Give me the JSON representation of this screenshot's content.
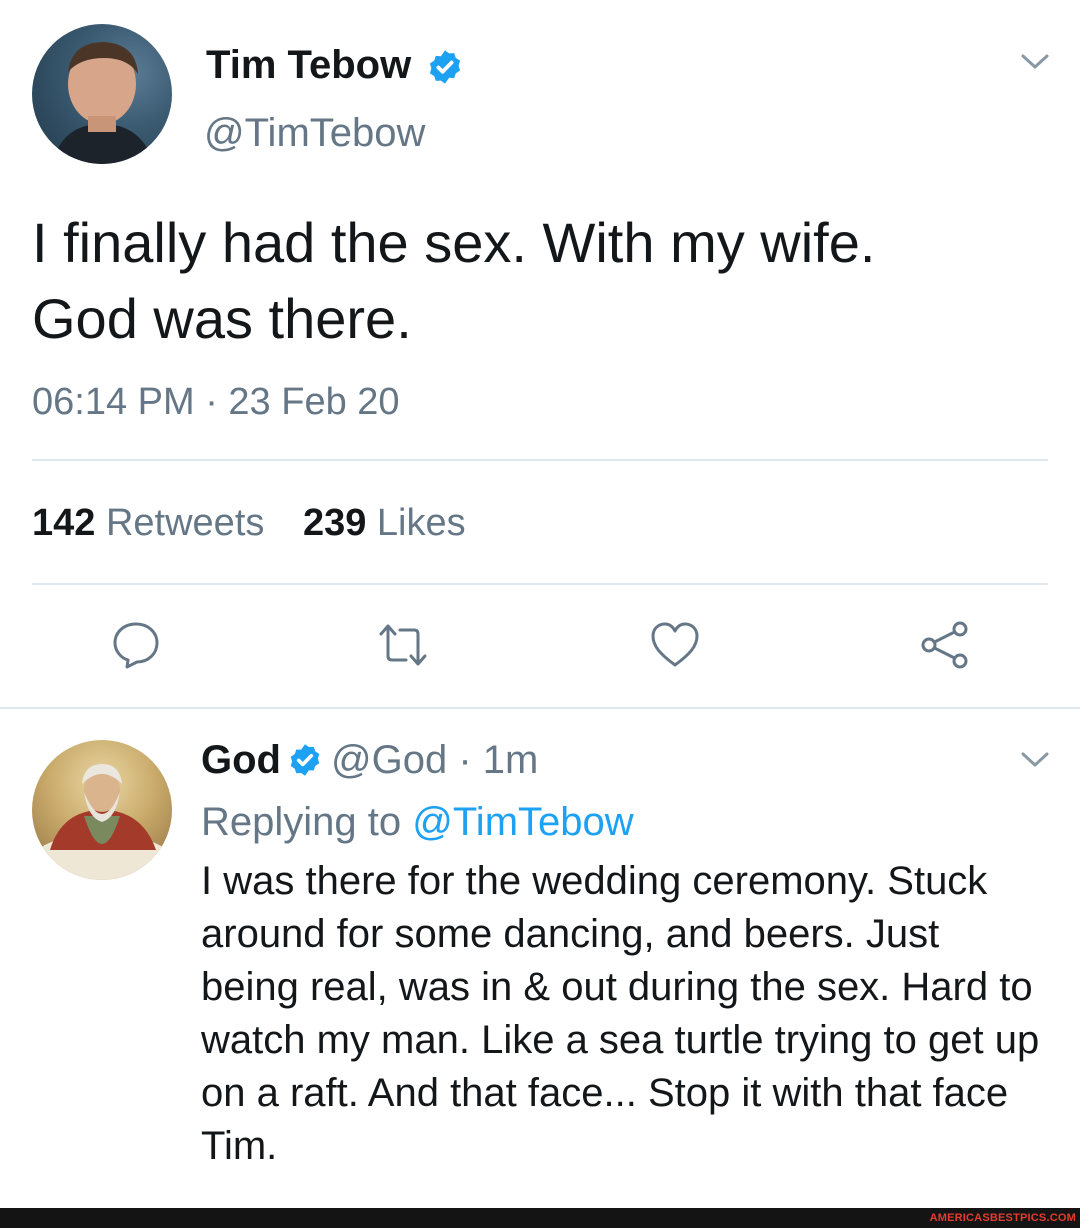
{
  "tweet": {
    "author": {
      "name": "Tim Tebow",
      "handle": "@TimTebow",
      "verified": true,
      "avatar": "tim-tebow-avatar"
    },
    "text": "I finally had the sex. With my wife.\n God was there.",
    "timestamp": "06:14 PM · 23 Feb 20",
    "stats": {
      "retweets_count": "142",
      "retweets_label": "Retweets",
      "likes_count": "239",
      "likes_label": "Likes"
    },
    "actions": [
      {
        "icon": "reply-icon"
      },
      {
        "icon": "retweet-icon"
      },
      {
        "icon": "like-icon"
      },
      {
        "icon": "share-icon"
      }
    ]
  },
  "reply": {
    "author": {
      "name": "God",
      "handle": "@God",
      "time": "· 1m",
      "verified": true,
      "avatar": "god-avatar"
    },
    "replying_to_label": "Replying to",
    "replying_to_handle": "@TimTebow",
    "text": "I was there for the wedding ceremony. Stuck around for some dancing, and beers. Just being real, was in & out during the sex. Hard to watch my man. Like a sea turtle trying to get up on a raft. And that face... Stop it with that face Tim."
  },
  "watermark": "AMERICASBESTPICS.COM",
  "colors": {
    "text": "#14171a",
    "secondary": "#657786",
    "accent": "#1da1f2",
    "divider": "#e1e8ed"
  }
}
